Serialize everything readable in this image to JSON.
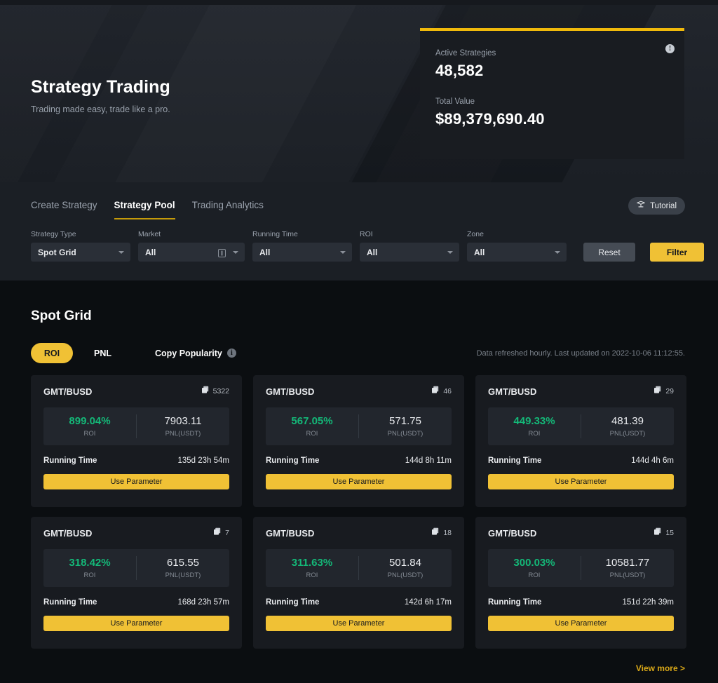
{
  "hero": {
    "title": "Strategy Trading",
    "subtitle": "Trading made easy, trade like a pro.",
    "stats": {
      "active_label": "Active Strategies",
      "active_value": "48,582",
      "total_label": "Total Value",
      "total_value": "$89,379,690.40",
      "info_icon": "info-icon",
      "accent_color": "#f0b90b"
    }
  },
  "nav": {
    "tabs": [
      {
        "label": "Create Strategy",
        "active": false
      },
      {
        "label": "Strategy Pool",
        "active": true
      },
      {
        "label": "Trading Analytics",
        "active": false
      }
    ],
    "tutorial": {
      "label": "Tutorial",
      "icon": "graduation-cap-icon"
    }
  },
  "filters": {
    "groups": [
      {
        "label": "Strategy Type",
        "value": "Spot Grid",
        "icon": null
      },
      {
        "label": "Market",
        "value": "All",
        "icon": "market-list-icon"
      },
      {
        "label": "Running Time",
        "value": "All",
        "icon": null
      },
      {
        "label": "ROI",
        "value": "All",
        "icon": null
      },
      {
        "label": "Zone",
        "value": "All",
        "icon": null
      }
    ],
    "reset_label": "Reset",
    "filter_label": "Filter"
  },
  "main": {
    "section_title": "Spot Grid",
    "pills": [
      {
        "label": "ROI",
        "active": true
      },
      {
        "label": "PNL",
        "active": false
      },
      {
        "label": "Copy Popularity",
        "active": false,
        "info_icon": "info-icon"
      }
    ],
    "refresh_note": "Data refreshed hourly. Last updated on 2022-10-06 11:12:55.",
    "view_more": "View more >",
    "card_labels": {
      "roi_caption": "ROI",
      "pnl_caption": "PNL(USDT)",
      "running_time": "Running Time",
      "use_parameter": "Use Parameter",
      "copy_icon": "copy-icon"
    },
    "cards": [
      {
        "pair": "GMT/BUSD",
        "copies": "5322",
        "roi": "899.04%",
        "pnl": "7903.11",
        "running": "135d 23h 54m"
      },
      {
        "pair": "GMT/BUSD",
        "copies": "46",
        "roi": "567.05%",
        "pnl": "571.75",
        "running": "144d 8h 11m"
      },
      {
        "pair": "GMT/BUSD",
        "copies": "29",
        "roi": "449.33%",
        "pnl": "481.39",
        "running": "144d 4h 6m"
      },
      {
        "pair": "GMT/BUSD",
        "copies": "7",
        "roi": "318.42%",
        "pnl": "615.55",
        "running": "168d 23h 57m"
      },
      {
        "pair": "GMT/BUSD",
        "copies": "18",
        "roi": "311.63%",
        "pnl": "501.84",
        "running": "142d 6h 17m"
      },
      {
        "pair": "GMT/BUSD",
        "copies": "15",
        "roi": "300.03%",
        "pnl": "10581.77",
        "running": "151d 22h 39m"
      }
    ]
  },
  "colors": {
    "accent": "#f0c135",
    "positive": "#14b878",
    "page_bg": "#0b0e11",
    "band_bg": "#1b1f25",
    "card_bg": "#181b20"
  }
}
